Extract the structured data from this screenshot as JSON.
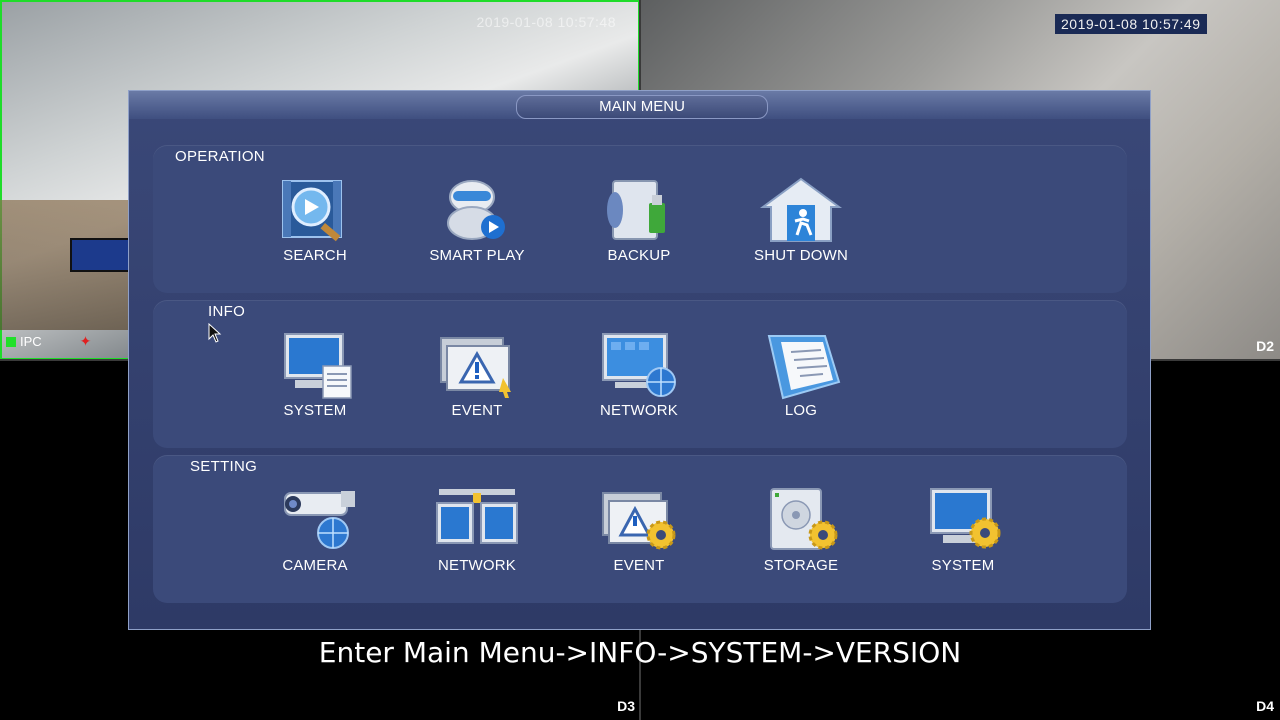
{
  "cameras": {
    "cam1": {
      "timestamp": "2019-01-08 10:57:48",
      "label": "IPC"
    },
    "cam2": {
      "timestamp": "2019-01-08 10:57:49",
      "label": "D2"
    },
    "cam3": {
      "label": "D3"
    },
    "cam4": {
      "label": "D4"
    }
  },
  "menu": {
    "title": "MAIN MENU",
    "sections": {
      "operation": {
        "title": "OPERATION",
        "items": [
          {
            "label": "SEARCH",
            "icon": "search-icon"
          },
          {
            "label": "SMART PLAY",
            "icon": "smart-play-icon"
          },
          {
            "label": "BACKUP",
            "icon": "backup-icon"
          },
          {
            "label": "SHUT DOWN",
            "icon": "shutdown-icon"
          }
        ]
      },
      "info": {
        "title": "INFO",
        "items": [
          {
            "label": "SYSTEM",
            "icon": "system-info-icon"
          },
          {
            "label": "EVENT",
            "icon": "event-info-icon"
          },
          {
            "label": "NETWORK",
            "icon": "network-info-icon"
          },
          {
            "label": "LOG",
            "icon": "log-icon"
          }
        ]
      },
      "setting": {
        "title": "SETTING",
        "items": [
          {
            "label": "CAMERA",
            "icon": "camera-icon"
          },
          {
            "label": "NETWORK",
            "icon": "network-setting-icon"
          },
          {
            "label": "EVENT",
            "icon": "event-setting-icon"
          },
          {
            "label": "STORAGE",
            "icon": "storage-icon"
          },
          {
            "label": "SYSTEM",
            "icon": "system-setting-icon"
          }
        ]
      }
    }
  },
  "caption": "Enter Main Menu->INFO->SYSTEM->VERSION",
  "colors": {
    "menu_bg": "#3a4878",
    "panel_bg": "#3b4a7a",
    "timestamp_bg": "#1a2a55",
    "ipc_status": "#22e02a"
  }
}
